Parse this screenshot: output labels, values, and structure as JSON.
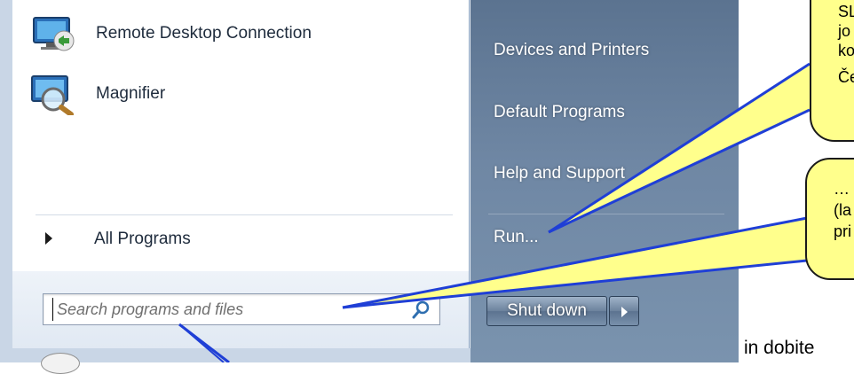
{
  "start_menu": {
    "pinned": [
      {
        "label": "Remote Desktop Connection",
        "icon": "remote-desktop-icon"
      },
      {
        "label": "Magnifier",
        "icon": "magnifier-icon"
      }
    ],
    "all_programs_label": "All Programs",
    "search": {
      "placeholder": "Search programs and files",
      "value": ""
    },
    "right_items": [
      {
        "label": "Devices and Printers"
      },
      {
        "label": "Default Programs"
      },
      {
        "label": "Help and Support"
      },
      {
        "label": "Run..."
      }
    ],
    "shutdown_label": "Shut down"
  },
  "callouts": [
    {
      "lines": [
        "SL",
        "jo",
        "ko",
        "Če"
      ]
    },
    {
      "lines": [
        "…",
        "(la",
        "pri"
      ]
    }
  ],
  "caption": "in dobite",
  "colors": {
    "callout_fill": "#ffff8c",
    "pointer_line": "#1f3fd6",
    "right_pane": "#6f87a4"
  }
}
